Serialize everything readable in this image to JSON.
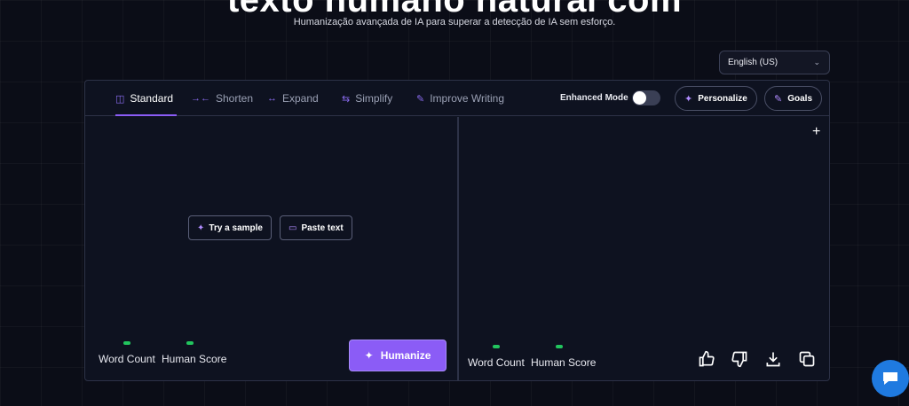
{
  "hero": {
    "title": "texto humano natural com",
    "subtitle": "Humanização avançada de IA para superar a detecção de IA sem esforço."
  },
  "language_select": {
    "value": "English (US)",
    "icon": "chevron-down-icon"
  },
  "tabs": [
    {
      "label": "Standard",
      "icon": "box-icon",
      "active": true
    },
    {
      "label": "Shorten",
      "icon": "shorten-arrows-icon",
      "active": false
    },
    {
      "label": "Expand",
      "icon": "expand-arrows-icon",
      "active": false
    },
    {
      "label": "Simplify",
      "icon": "swap-arrows-icon",
      "active": false
    },
    {
      "label": "Improve Writing",
      "icon": "chat-edit-icon",
      "active": false
    }
  ],
  "enhanced_mode": {
    "label": "Enhanced Mode",
    "enabled": false
  },
  "buttons": {
    "personalize": "Personalize",
    "goals": "Goals",
    "try_sample": "Try a sample",
    "paste_text": "Paste text",
    "humanize": "Humanize"
  },
  "left_stats": {
    "word_count": "Word Count",
    "human_score": "Human Score"
  },
  "right_stats": {
    "word_count": "Word Count",
    "human_score": "Human Score"
  },
  "output_actions": [
    "thumbs-up-icon",
    "thumbs-down-icon",
    "download-icon",
    "copy-icon"
  ],
  "colors": {
    "accent": "#8b5cf6",
    "status_dot": "#22c55e",
    "chat_bubble": "#1f7ae0"
  }
}
